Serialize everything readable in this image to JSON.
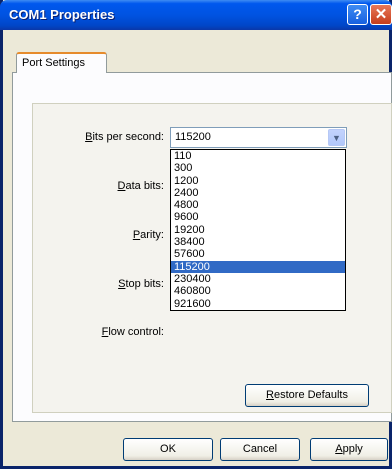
{
  "window": {
    "title": "COM1 Properties",
    "help_label": "?",
    "close_label": "✕"
  },
  "tabs": [
    {
      "label": "Port Settings"
    }
  ],
  "fields": {
    "bits_per_second": {
      "label": "Bits per second:",
      "underline": "B",
      "value": "115200",
      "open": true
    },
    "data_bits": {
      "label": "Data bits:",
      "underline": "D"
    },
    "parity": {
      "label": "Parity:",
      "underline": "P"
    },
    "stop_bits": {
      "label": "Stop bits:",
      "underline": "S"
    },
    "flow_control": {
      "label": "Flow control:",
      "underline": "F"
    }
  },
  "dropdown_options": [
    "110",
    "300",
    "1200",
    "2400",
    "4800",
    "9600",
    "19200",
    "38400",
    "57600",
    "115200",
    "230400",
    "460800",
    "921600"
  ],
  "selected_option": "115200",
  "buttons": {
    "restore_defaults": "Restore Defaults",
    "ok": "OK",
    "cancel": "Cancel",
    "apply": "Apply"
  },
  "icons": {
    "combo_arrow": "chevron-down-icon",
    "help": "help-icon",
    "close": "close-icon"
  },
  "colors": {
    "titlebar": "#0053e1",
    "selection": "#316ac5",
    "tab_accent": "#e68b2c",
    "face": "#ece9d8"
  }
}
